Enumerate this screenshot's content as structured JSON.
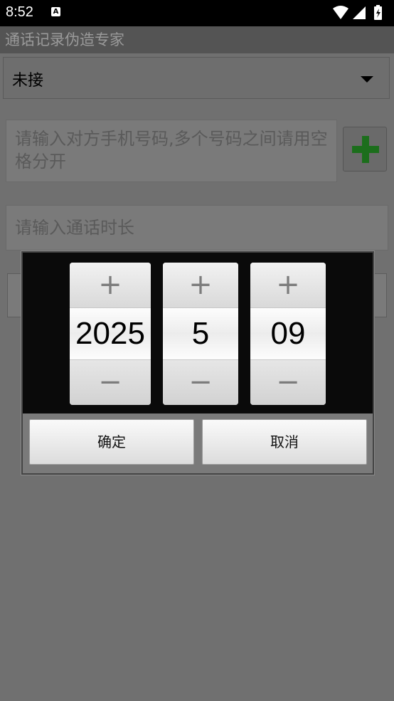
{
  "status": {
    "time": "8:52",
    "a_badge": "A"
  },
  "app": {
    "title": "通话记录伪造专家"
  },
  "form": {
    "call_type": "未接",
    "phone_placeholder": "请输入对方手机号码,多个号码之间请用空格分开",
    "duration_placeholder": "请输入通话时长"
  },
  "date_picker": {
    "year": "2025",
    "month": "5",
    "day": "09",
    "plus": "+",
    "minus": "−",
    "confirm": "确定",
    "cancel": "取消"
  },
  "colors": {
    "add_icon": "#1c6e1c",
    "overlay": "#707070"
  }
}
